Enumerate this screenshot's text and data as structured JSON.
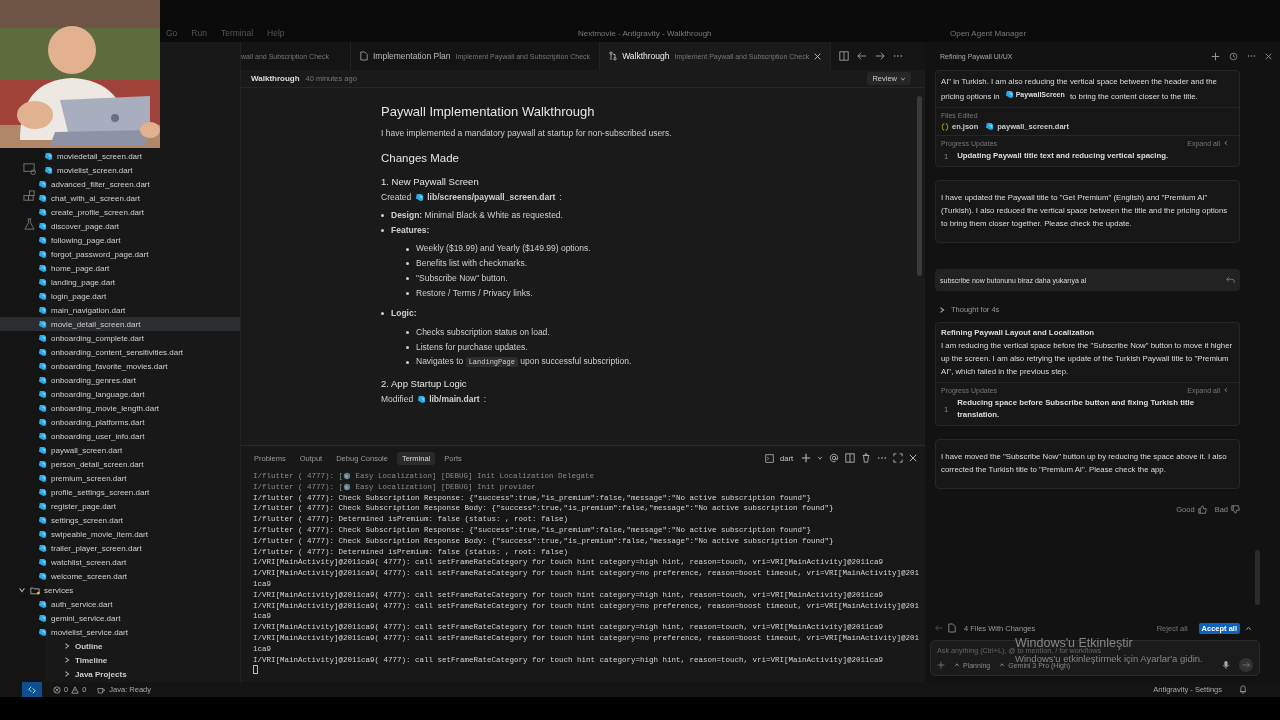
{
  "menu": [
    "Go",
    "Run",
    "Terminal",
    "Help"
  ],
  "window": {
    "title": "Nextmovie - Antigravity - Walkthrough"
  },
  "agent_manager": "Open Agent Manager",
  "webcam": {
    "kind": "picture"
  },
  "editor_tabs": [
    {
      "kind": "cut",
      "description": "wall and Subscription Check",
      "selected": false
    },
    {
      "kind": "plan",
      "label": "Implementation Plan",
      "description": "Implement Paywall and Subscription Check",
      "selected": false
    },
    {
      "kind": "walkthrough",
      "label": "Walkthrough",
      "description": "Implement Paywall and Subscription Check",
      "selected": true
    }
  ],
  "explorer": {
    "tree": [
      {
        "kind": "group",
        "children": [
          {
            "kind": "file",
            "name": "moviedetail_screen.dart",
            "selected": false
          },
          {
            "kind": "file",
            "name": "movielist_screen.dart",
            "selected": false
          }
        ]
      },
      {
        "kind": "file",
        "name": "advanced_filter_screen.dart",
        "selected": false
      },
      {
        "kind": "file",
        "name": "chat_with_ai_screen.dart",
        "selected": false
      },
      {
        "kind": "file",
        "name": "create_profile_screen.dart",
        "selected": false
      },
      {
        "kind": "file",
        "name": "discover_page.dart",
        "selected": false
      },
      {
        "kind": "file",
        "name": "following_page.dart",
        "selected": false
      },
      {
        "kind": "file",
        "name": "forgot_password_page.dart",
        "selected": false
      },
      {
        "kind": "file",
        "name": "home_page.dart",
        "selected": false
      },
      {
        "kind": "file",
        "name": "landing_page.dart",
        "selected": false
      },
      {
        "kind": "file",
        "name": "login_page.dart",
        "selected": false
      },
      {
        "kind": "file",
        "name": "main_navigation.dart",
        "selected": false
      },
      {
        "kind": "file",
        "name": "movie_detail_screen.dart",
        "selected": true
      },
      {
        "kind": "file",
        "name": "onboarding_complete.dart",
        "selected": false
      },
      {
        "kind": "file",
        "name": "onboarding_content_sensitivities.dart",
        "selected": false
      },
      {
        "kind": "file",
        "name": "onboarding_favorite_movies.dart",
        "selected": false
      },
      {
        "kind": "file",
        "name": "onboarding_genres.dart",
        "selected": false
      },
      {
        "kind": "file",
        "name": "onboarding_language.dart",
        "selected": false
      },
      {
        "kind": "file",
        "name": "onboarding_movie_length.dart",
        "selected": false
      },
      {
        "kind": "file",
        "name": "onboarding_platforms.dart",
        "selected": false
      },
      {
        "kind": "file",
        "name": "onboarding_user_info.dart",
        "selected": false
      },
      {
        "kind": "file",
        "name": "paywall_screen.dart",
        "selected": false
      },
      {
        "kind": "file",
        "name": "person_detail_screen.dart",
        "selected": false
      },
      {
        "kind": "file",
        "name": "premium_screen.dart",
        "selected": false
      },
      {
        "kind": "file",
        "name": "profile_settings_screen.dart",
        "selected": false
      },
      {
        "kind": "file",
        "name": "register_page.dart",
        "selected": false
      },
      {
        "kind": "file",
        "name": "settings_screen.dart",
        "selected": false
      },
      {
        "kind": "file",
        "name": "swipeable_movie_item.dart",
        "selected": false
      },
      {
        "kind": "file",
        "name": "trailer_player_screen.dart",
        "selected": false
      },
      {
        "kind": "file",
        "name": "watchlist_screen.dart",
        "selected": false
      },
      {
        "kind": "file",
        "name": "welcome_screen.dart",
        "selected": false
      },
      {
        "kind": "folder",
        "name": "services",
        "expanded": true,
        "children": [
          {
            "kind": "file",
            "name": "auth_service.dart",
            "selected": false
          },
          {
            "kind": "file",
            "name": "gemini_service.dart",
            "selected": false
          },
          {
            "kind": "file",
            "name": "movielist_service.dart",
            "selected": false
          }
        ]
      }
    ],
    "sections": [
      {
        "label": "Outline",
        "expanded": false
      },
      {
        "label": "Timeline",
        "expanded": false
      },
      {
        "label": "Java Projects",
        "expanded": false
      }
    ]
  },
  "document": {
    "header": "Walkthrough",
    "time": "40 minutes ago",
    "review": "Review",
    "blocks": [
      {
        "kind": "h1",
        "text": "Paywall Implementation Walkthrough"
      },
      {
        "kind": "p",
        "text": "I have implemented a mandatory paywall at startup for non-subscribed users."
      },
      {
        "kind": "h2",
        "text": "Changes Made"
      },
      {
        "kind": "h3",
        "text": "1. New Paywall Screen"
      },
      {
        "kind": "file",
        "verb": "Created",
        "path": "lib/screens/paywall_screen.dart",
        "suffix": ":"
      },
      {
        "kind": "list",
        "items": [
          {
            "text": "**Design:** Minimal Black & White as requested."
          },
          {
            "text": "**Features:**",
            "children": [
              {
                "text": "Weekly ($19.99) and Yearly ($149.99) options."
              },
              {
                "text": "Benefits list with checkmarks."
              },
              {
                "text": "\"Subscribe Now\" button."
              },
              {
                "text": "Restore / Terms / Privacy links."
              }
            ]
          },
          {
            "text": "**Logic:**",
            "children": [
              {
                "text": "Checks subscription status on load."
              },
              {
                "text": "Listens for purchase updates."
              },
              {
                "text": "Navigates to ",
                "code": "LandingPage",
                "after": " upon successful subscription."
              }
            ]
          }
        ]
      },
      {
        "kind": "h3",
        "text": "2. App Startup Logic"
      },
      {
        "kind": "file",
        "verb": "Modified",
        "path": "lib/main.dart",
        "suffix": ":"
      }
    ]
  },
  "terminal": {
    "tabs": [
      {
        "label": "Problems",
        "selected": false
      },
      {
        "label": "Output",
        "selected": false
      },
      {
        "label": "Debug Console",
        "selected": false
      },
      {
        "label": "Terminal",
        "selected": true
      },
      {
        "label": "Ports",
        "selected": false
      }
    ],
    "shell": "dart",
    "lines": [
      {
        "kind": "globe",
        "prefix": "I/flutter ( 4777): [",
        "text": " Easy Localization] [DEBUG] Init Localization Delegate"
      },
      {
        "kind": "globe",
        "prefix": "I/flutter ( 4777): [",
        "text": " Easy Localization] [DEBUG] Init provider"
      },
      {
        "kind": "plain",
        "text": "I/flutter ( 4777): Check Subscription Response: {\"success\":true,\"is_premium\":false,\"message\":\"No active subscription found\"}"
      },
      {
        "kind": "plain",
        "text": "I/flutter ( 4777): Check Subscription Response Body: {\"success\":true,\"is_premium\":false,\"message\":\"No active subscription found\"}"
      },
      {
        "kind": "plain",
        "text": "I/flutter ( 4777): Determined isPremium: false (status: , root: false)"
      },
      {
        "kind": "plain",
        "text": "I/flutter ( 4777): Check Subscription Response: {\"success\":true,\"is_premium\":false,\"message\":\"No active subscription found\"}"
      },
      {
        "kind": "plain",
        "text": "I/flutter ( 4777): Check Subscription Response Body: {\"success\":true,\"is_premium\":false,\"message\":\"No active subscription found\"}"
      },
      {
        "kind": "plain",
        "text": "I/flutter ( 4777): Determined isPremium: false (status: , root: false)"
      },
      {
        "kind": "plain",
        "text": "I/VRI[MainActivity]@2011ca9( 4777): call setFrameRateCategory for touch hint category=high hint, reason=touch, vri=VRI[MainActivity]@2011ca9"
      },
      {
        "kind": "plain",
        "text": "I/VRI[MainActivity]@2011ca9( 4777): call setFrameRateCategory for touch hint category=no preference, reason=boost timeout, vri=VRI[MainActivity]@2011ca9"
      },
      {
        "kind": "plain",
        "text": "I/VRI[MainActivity]@2011ca9( 4777): call setFrameRateCategory for touch hint category=high hint, reason=touch, vri=VRI[MainActivity]@2011ca9"
      },
      {
        "kind": "plain",
        "text": "I/VRI[MainActivity]@2011ca9( 4777): call setFrameRateCategory for touch hint category=no preference, reason=boost timeout, vri=VRI[MainActivity]@2011ca9"
      },
      {
        "kind": "plain",
        "text": "I/VRI[MainActivity]@2011ca9( 4777): call setFrameRateCategory for touch hint category=high hint, reason=touch, vri=VRI[MainActivity]@2011ca9"
      },
      {
        "kind": "plain",
        "text": "I/VRI[MainActivity]@2011ca9( 4777): call setFrameRateCategory for touch hint category=no preference, reason=boost timeout, vri=VRI[MainActivity]@2011ca9"
      },
      {
        "kind": "plain",
        "text": "I/VRI[MainActivity]@2011ca9( 4777): call setFrameRateCategory for touch hint category=high hint, reason=touch, vri=VRI[MainActivity]@2011ca9"
      }
    ]
  },
  "chat": {
    "title": "Refining Paywall UI/UX",
    "blocks": [
      {
        "kind": "step",
        "text": "AI\" in Turkish. I am also reducing the vertical space between the header and the pricing options in ",
        "ref": "PaywallScreen",
        "after": " to bring the content closer to the title.",
        "files_label": "Files Edited",
        "files": [
          {
            "kind": "json",
            "name": "en.json"
          },
          {
            "kind": "dart",
            "name": "paywall_screen.dart"
          }
        ],
        "progress_label": "Progress Updates",
        "expand": "Expand all",
        "updates": [
          {
            "num": "1",
            "text": "Updating Paywall title text and reducing vertical spacing."
          }
        ]
      },
      {
        "kind": "reply",
        "text": "I have updated the Paywall title to \"Get Premium\" (English) and \"Premium AI\" (Turkish). I also reduced the vertical space between the title and the pricing options to bring them closer together. Please check the update."
      },
      {
        "kind": "user",
        "text": "subscribe now butonunu biraz daha yukarıya al"
      },
      {
        "kind": "thought",
        "text": "Thought for 4s",
        "expanded": false
      },
      {
        "kind": "step",
        "title": "Refining Paywall Layout and Localization",
        "text": "I am reducing the vertical space before the \"Subscribe Now\" button to move it higher up the screen. I am also retrying the update of the Turkish Paywall title to \"Premium AI\", which failed in the previous step.",
        "progress_label": "Progress Updates",
        "expand": "Expand all",
        "updates": [
          {
            "num": "1",
            "text": "Reducing space before Subscribe button and fixing Turkish title translation."
          }
        ]
      },
      {
        "kind": "reply",
        "text": "I have moved the \"Subscribe Now\" button up by reducing the space above it. I also corrected the Turkish title to \"Premium AI\". Please check the app."
      }
    ],
    "feedback": {
      "good": "Good",
      "bad": "Bad"
    },
    "changes": {
      "label": "4 Files With Changes",
      "reject": "Reject all",
      "accept": "Accept all"
    },
    "input": {
      "placeholder": "Ask anything (Ctrl+L), @ to mention, / for workflows",
      "mode": "Planning",
      "model": "Gemini 3 Pro (High)"
    }
  },
  "activation": {
    "title": "Windows'u Etkinleştir",
    "text": "Windows'u etkinleştirmek için Ayarlar'a gidin."
  },
  "status_bar": {
    "errors": "0",
    "warnings": "0",
    "java": "Java: Ready",
    "right": "Antigravity - Settings"
  }
}
